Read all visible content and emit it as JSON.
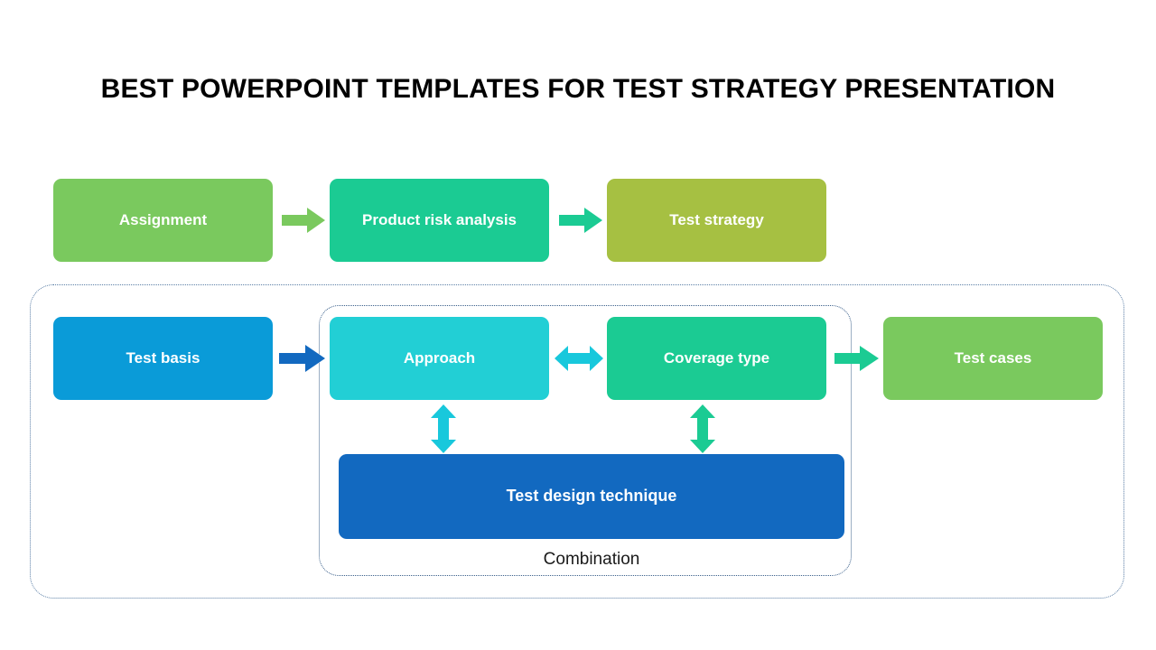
{
  "slide": {
    "title": "BEST POWERPOINT TEMPLATES FOR TEST STRATEGY PRESENTATION",
    "background_color": "#FFFFFF"
  },
  "diagram": {
    "rows": {
      "row1": [
        {
          "id": "assignment",
          "label": "Assignment",
          "color": "#7AC95E"
        },
        {
          "id": "product_risk_analysis",
          "label": "Product risk analysis",
          "color": "#1BCB93"
        },
        {
          "id": "test_strategy",
          "label": "Test strategy",
          "color": "#A6C042"
        }
      ],
      "row2": [
        {
          "id": "test_basis",
          "label": "Test basis",
          "color": "#0A9BD8"
        },
        {
          "id": "approach",
          "label": "Approach",
          "color": "#22CFD5"
        },
        {
          "id": "coverage_type",
          "label": "Coverage type",
          "color": "#1BCB93"
        },
        {
          "id": "test_cases",
          "label": "Test cases",
          "color": "#7AC95E"
        }
      ],
      "row3": [
        {
          "id": "test_design_technique",
          "label": "Test design technique",
          "color": "#1269C0"
        }
      ]
    },
    "group_label": "Combination",
    "connectors": [
      {
        "id": "assignment-to-product",
        "icon": "arrow-right-icon",
        "direction": "right",
        "color": "#7AC95E"
      },
      {
        "id": "product-to-strategy",
        "icon": "arrow-right-icon",
        "direction": "right",
        "color": "#1BCB93"
      },
      {
        "id": "basis-to-approach",
        "icon": "arrow-right-icon",
        "direction": "right",
        "color": "#1269C0"
      },
      {
        "id": "approach-coverage",
        "icon": "arrow-left-right-icon",
        "direction": "both-horizontal",
        "color": "#18C8DC"
      },
      {
        "id": "coverage-to-cases",
        "icon": "arrow-right-icon",
        "direction": "right",
        "color": "#1BCB93"
      },
      {
        "id": "approach-design",
        "icon": "arrow-up-down-icon",
        "direction": "both-vertical",
        "color": "#18C8DC"
      },
      {
        "id": "coverage-design",
        "icon": "arrow-up-down-icon",
        "direction": "both-vertical",
        "color": "#1BCB93"
      }
    ],
    "containers": [
      {
        "id": "outer-group",
        "border_color": "#5B7FA6",
        "border_style": "dotted"
      },
      {
        "id": "inner-combination-group",
        "border_color": "#3A5F8A",
        "border_style": "dotted"
      }
    ]
  }
}
